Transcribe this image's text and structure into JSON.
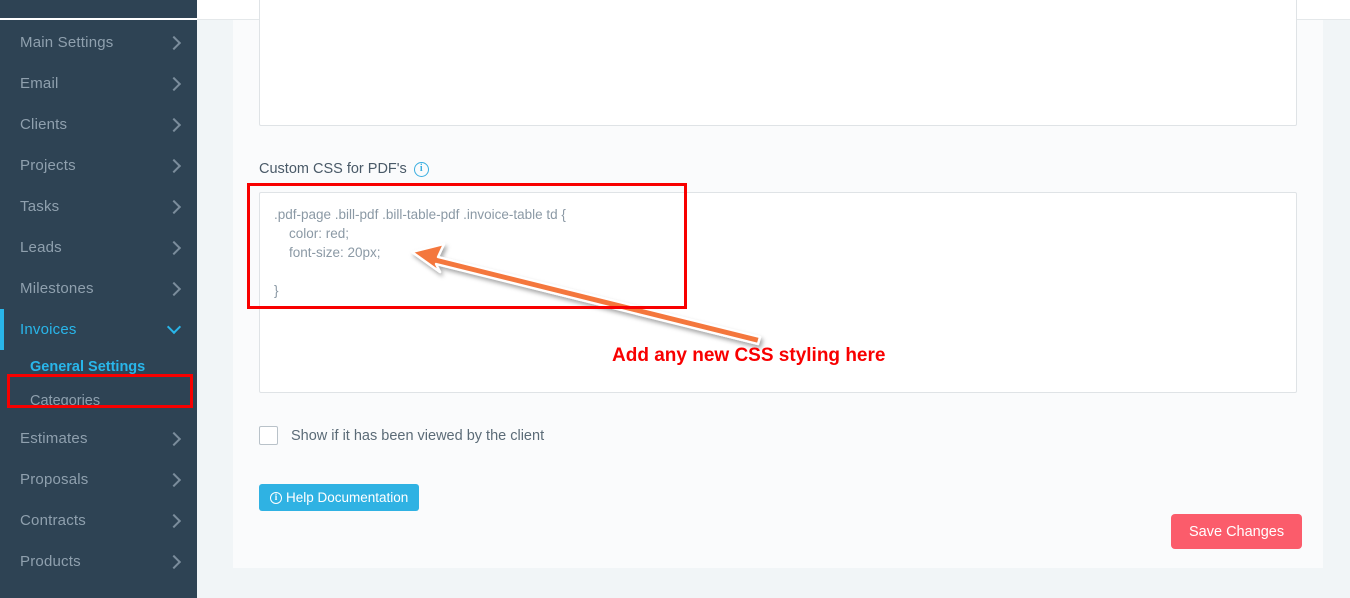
{
  "sidebar": {
    "items": [
      {
        "label": "Main Settings",
        "icon": "chevron-right-icon",
        "state": "collapsed"
      },
      {
        "label": "Email",
        "icon": "chevron-right-icon",
        "state": "collapsed"
      },
      {
        "label": "Clients",
        "icon": "chevron-right-icon",
        "state": "collapsed"
      },
      {
        "label": "Projects",
        "icon": "chevron-right-icon",
        "state": "collapsed"
      },
      {
        "label": "Tasks",
        "icon": "chevron-right-icon",
        "state": "collapsed"
      },
      {
        "label": "Leads",
        "icon": "chevron-right-icon",
        "state": "collapsed"
      },
      {
        "label": "Milestones",
        "icon": "chevron-right-icon",
        "state": "collapsed"
      },
      {
        "label": "Invoices",
        "icon": "chevron-down-icon",
        "state": "expanded"
      },
      {
        "label": "Estimates",
        "icon": "chevron-right-icon",
        "state": "collapsed"
      },
      {
        "label": "Proposals",
        "icon": "chevron-right-icon",
        "state": "collapsed"
      },
      {
        "label": "Contracts",
        "icon": "chevron-right-icon",
        "state": "collapsed"
      },
      {
        "label": "Products",
        "icon": "chevron-right-icon",
        "state": "collapsed"
      }
    ],
    "sub_items": [
      {
        "label": "General Settings",
        "selected": true
      },
      {
        "label": "Categories",
        "selected": false
      }
    ],
    "active_color": "#29b6ea",
    "background_color": "#2e4354",
    "text_color": "#8fa0ae"
  },
  "main": {
    "top_textarea_value": "",
    "css_field": {
      "label": "Custom CSS for PDF's",
      "info_icon": "info-circle-icon",
      "info_glyph": "i",
      "value": ".pdf-page .bill-pdf .bill-table-pdf .invoice-table td {\n    color: red;\n    font-size: 20px;\n\n}"
    },
    "checkbox": {
      "label": "Show if it has been viewed by the client",
      "checked": false
    },
    "help_button": {
      "label": "Help Documentation",
      "icon": "info-circle-icon",
      "icon_glyph": "i",
      "color": "#2fb2e3"
    },
    "save_button": {
      "label": "Save Changes",
      "color": "#fb5c6b"
    }
  },
  "annotations": {
    "callout_text": "Add any new CSS styling here",
    "callout_color": "#f80000",
    "box_color": "#f80000",
    "arrow_color": "#f4773c"
  }
}
